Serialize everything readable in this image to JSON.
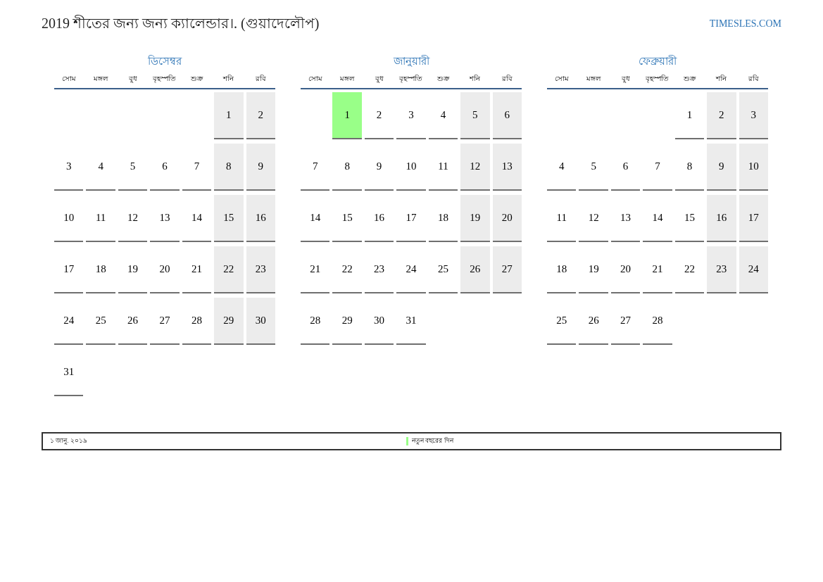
{
  "title": "2019 শীতের জন্য জন্য ক্যালেন্ডার।. (গুয়াদেলৌপ)",
  "site_link": "TIMESLES.COM",
  "months": [
    {
      "name": "ডিসেম্বর",
      "weekdays": [
        "সোম",
        "মঙ্গল",
        "বুধ",
        "বৃহস্পতি",
        "শুক্র",
        "শনি",
        "রবি"
      ],
      "weeks": [
        [
          {
            "kind": "blank"
          },
          {
            "kind": "blank"
          },
          {
            "kind": "blank"
          },
          {
            "kind": "blank"
          },
          {
            "kind": "blank"
          },
          {
            "kind": "day",
            "day": "1",
            "weekend": true
          },
          {
            "kind": "day",
            "day": "2",
            "weekend": true
          }
        ],
        [
          {
            "kind": "day",
            "day": "3",
            "weekend": false
          },
          {
            "kind": "day",
            "day": "4",
            "weekend": false
          },
          {
            "kind": "day",
            "day": "5",
            "weekend": false
          },
          {
            "kind": "day",
            "day": "6",
            "weekend": false
          },
          {
            "kind": "day",
            "day": "7",
            "weekend": false
          },
          {
            "kind": "day",
            "day": "8",
            "weekend": true
          },
          {
            "kind": "day",
            "day": "9",
            "weekend": true
          }
        ],
        [
          {
            "kind": "day",
            "day": "10",
            "weekend": false
          },
          {
            "kind": "day",
            "day": "11",
            "weekend": false
          },
          {
            "kind": "day",
            "day": "12",
            "weekend": false
          },
          {
            "kind": "day",
            "day": "13",
            "weekend": false
          },
          {
            "kind": "day",
            "day": "14",
            "weekend": false
          },
          {
            "kind": "day",
            "day": "15",
            "weekend": true
          },
          {
            "kind": "day",
            "day": "16",
            "weekend": true
          }
        ],
        [
          {
            "kind": "day",
            "day": "17",
            "weekend": false
          },
          {
            "kind": "day",
            "day": "18",
            "weekend": false
          },
          {
            "kind": "day",
            "day": "19",
            "weekend": false
          },
          {
            "kind": "day",
            "day": "20",
            "weekend": false
          },
          {
            "kind": "day",
            "day": "21",
            "weekend": false
          },
          {
            "kind": "day",
            "day": "22",
            "weekend": true
          },
          {
            "kind": "day",
            "day": "23",
            "weekend": true
          }
        ],
        [
          {
            "kind": "day",
            "day": "24",
            "weekend": false
          },
          {
            "kind": "day",
            "day": "25",
            "weekend": false
          },
          {
            "kind": "day",
            "day": "26",
            "weekend": false
          },
          {
            "kind": "day",
            "day": "27",
            "weekend": false
          },
          {
            "kind": "day",
            "day": "28",
            "weekend": false
          },
          {
            "kind": "day",
            "day": "29",
            "weekend": true
          },
          {
            "kind": "day",
            "day": "30",
            "weekend": true
          }
        ],
        [
          {
            "kind": "day",
            "day": "31",
            "weekend": false
          }
        ]
      ]
    },
    {
      "name": "জানুয়ারী",
      "weekdays": [
        "সোম",
        "মঙ্গল",
        "বুধ",
        "বৃহস্পতি",
        "শুক্র",
        "শনি",
        "রবি"
      ],
      "weeks": [
        [
          {
            "kind": "blank"
          },
          {
            "kind": "day",
            "day": "1",
            "color": "#99ff88"
          },
          {
            "kind": "day",
            "day": "2",
            "weekend": false
          },
          {
            "kind": "day",
            "day": "3",
            "weekend": false
          },
          {
            "kind": "day",
            "day": "4",
            "weekend": false
          },
          {
            "kind": "day",
            "day": "5",
            "weekend": true
          },
          {
            "kind": "day",
            "day": "6",
            "weekend": true
          }
        ],
        [
          {
            "kind": "day",
            "day": "7",
            "weekend": false
          },
          {
            "kind": "day",
            "day": "8",
            "weekend": false
          },
          {
            "kind": "day",
            "day": "9",
            "weekend": false
          },
          {
            "kind": "day",
            "day": "10",
            "weekend": false
          },
          {
            "kind": "day",
            "day": "11",
            "weekend": false
          },
          {
            "kind": "day",
            "day": "12",
            "weekend": true
          },
          {
            "kind": "day",
            "day": "13",
            "weekend": true
          }
        ],
        [
          {
            "kind": "day",
            "day": "14",
            "weekend": false
          },
          {
            "kind": "day",
            "day": "15",
            "weekend": false
          },
          {
            "kind": "day",
            "day": "16",
            "weekend": false
          },
          {
            "kind": "day",
            "day": "17",
            "weekend": false
          },
          {
            "kind": "day",
            "day": "18",
            "weekend": false
          },
          {
            "kind": "day",
            "day": "19",
            "weekend": true
          },
          {
            "kind": "day",
            "day": "20",
            "weekend": true
          }
        ],
        [
          {
            "kind": "day",
            "day": "21",
            "weekend": false
          },
          {
            "kind": "day",
            "day": "22",
            "weekend": false
          },
          {
            "kind": "day",
            "day": "23",
            "weekend": false
          },
          {
            "kind": "day",
            "day": "24",
            "weekend": false
          },
          {
            "kind": "day",
            "day": "25",
            "weekend": false
          },
          {
            "kind": "day",
            "day": "26",
            "weekend": true
          },
          {
            "kind": "day",
            "day": "27",
            "weekend": true
          }
        ],
        [
          {
            "kind": "day",
            "day": "28",
            "weekend": false
          },
          {
            "kind": "day",
            "day": "29",
            "weekend": false
          },
          {
            "kind": "day",
            "day": "30",
            "weekend": false
          },
          {
            "kind": "day",
            "day": "31",
            "weekend": false
          }
        ]
      ]
    },
    {
      "name": "ফেব্রুয়ারী",
      "weekdays": [
        "সোম",
        "মঙ্গল",
        "বুধ",
        "বৃহস্পতি",
        "শুক্র",
        "শনি",
        "রবি"
      ],
      "weeks": [
        [
          {
            "kind": "blank"
          },
          {
            "kind": "blank"
          },
          {
            "kind": "blank"
          },
          {
            "kind": "blank"
          },
          {
            "kind": "day",
            "day": "1",
            "weekend": false
          },
          {
            "kind": "day",
            "day": "2",
            "weekend": true
          },
          {
            "kind": "day",
            "day": "3",
            "weekend": true
          }
        ],
        [
          {
            "kind": "day",
            "day": "4",
            "weekend": false
          },
          {
            "kind": "day",
            "day": "5",
            "weekend": false
          },
          {
            "kind": "day",
            "day": "6",
            "weekend": false
          },
          {
            "kind": "day",
            "day": "7",
            "weekend": false
          },
          {
            "kind": "day",
            "day": "8",
            "weekend": false
          },
          {
            "kind": "day",
            "day": "9",
            "weekend": true
          },
          {
            "kind": "day",
            "day": "10",
            "weekend": true
          }
        ],
        [
          {
            "kind": "day",
            "day": "11",
            "weekend": false
          },
          {
            "kind": "day",
            "day": "12",
            "weekend": false
          },
          {
            "kind": "day",
            "day": "13",
            "weekend": false
          },
          {
            "kind": "day",
            "day": "14",
            "weekend": false
          },
          {
            "kind": "day",
            "day": "15",
            "weekend": false
          },
          {
            "kind": "day",
            "day": "16",
            "weekend": true
          },
          {
            "kind": "day",
            "day": "17",
            "weekend": true
          }
        ],
        [
          {
            "kind": "day",
            "day": "18",
            "weekend": false
          },
          {
            "kind": "day",
            "day": "19",
            "weekend": false
          },
          {
            "kind": "day",
            "day": "20",
            "weekend": false
          },
          {
            "kind": "day",
            "day": "21",
            "weekend": false
          },
          {
            "kind": "day",
            "day": "22",
            "weekend": false
          },
          {
            "kind": "day",
            "day": "23",
            "weekend": true
          },
          {
            "kind": "day",
            "day": "24",
            "weekend": true
          }
        ],
        [
          {
            "kind": "day",
            "day": "25",
            "weekend": false
          },
          {
            "kind": "day",
            "day": "26",
            "weekend": false
          },
          {
            "kind": "day",
            "day": "27",
            "weekend": false
          },
          {
            "kind": "day",
            "day": "28",
            "weekend": false
          }
        ]
      ]
    }
  ],
  "legend": {
    "date": "১ জানু. ২০১৯",
    "holiday": {
      "name": "নতুন বছরের দিন",
      "color": "#99ff88"
    }
  }
}
